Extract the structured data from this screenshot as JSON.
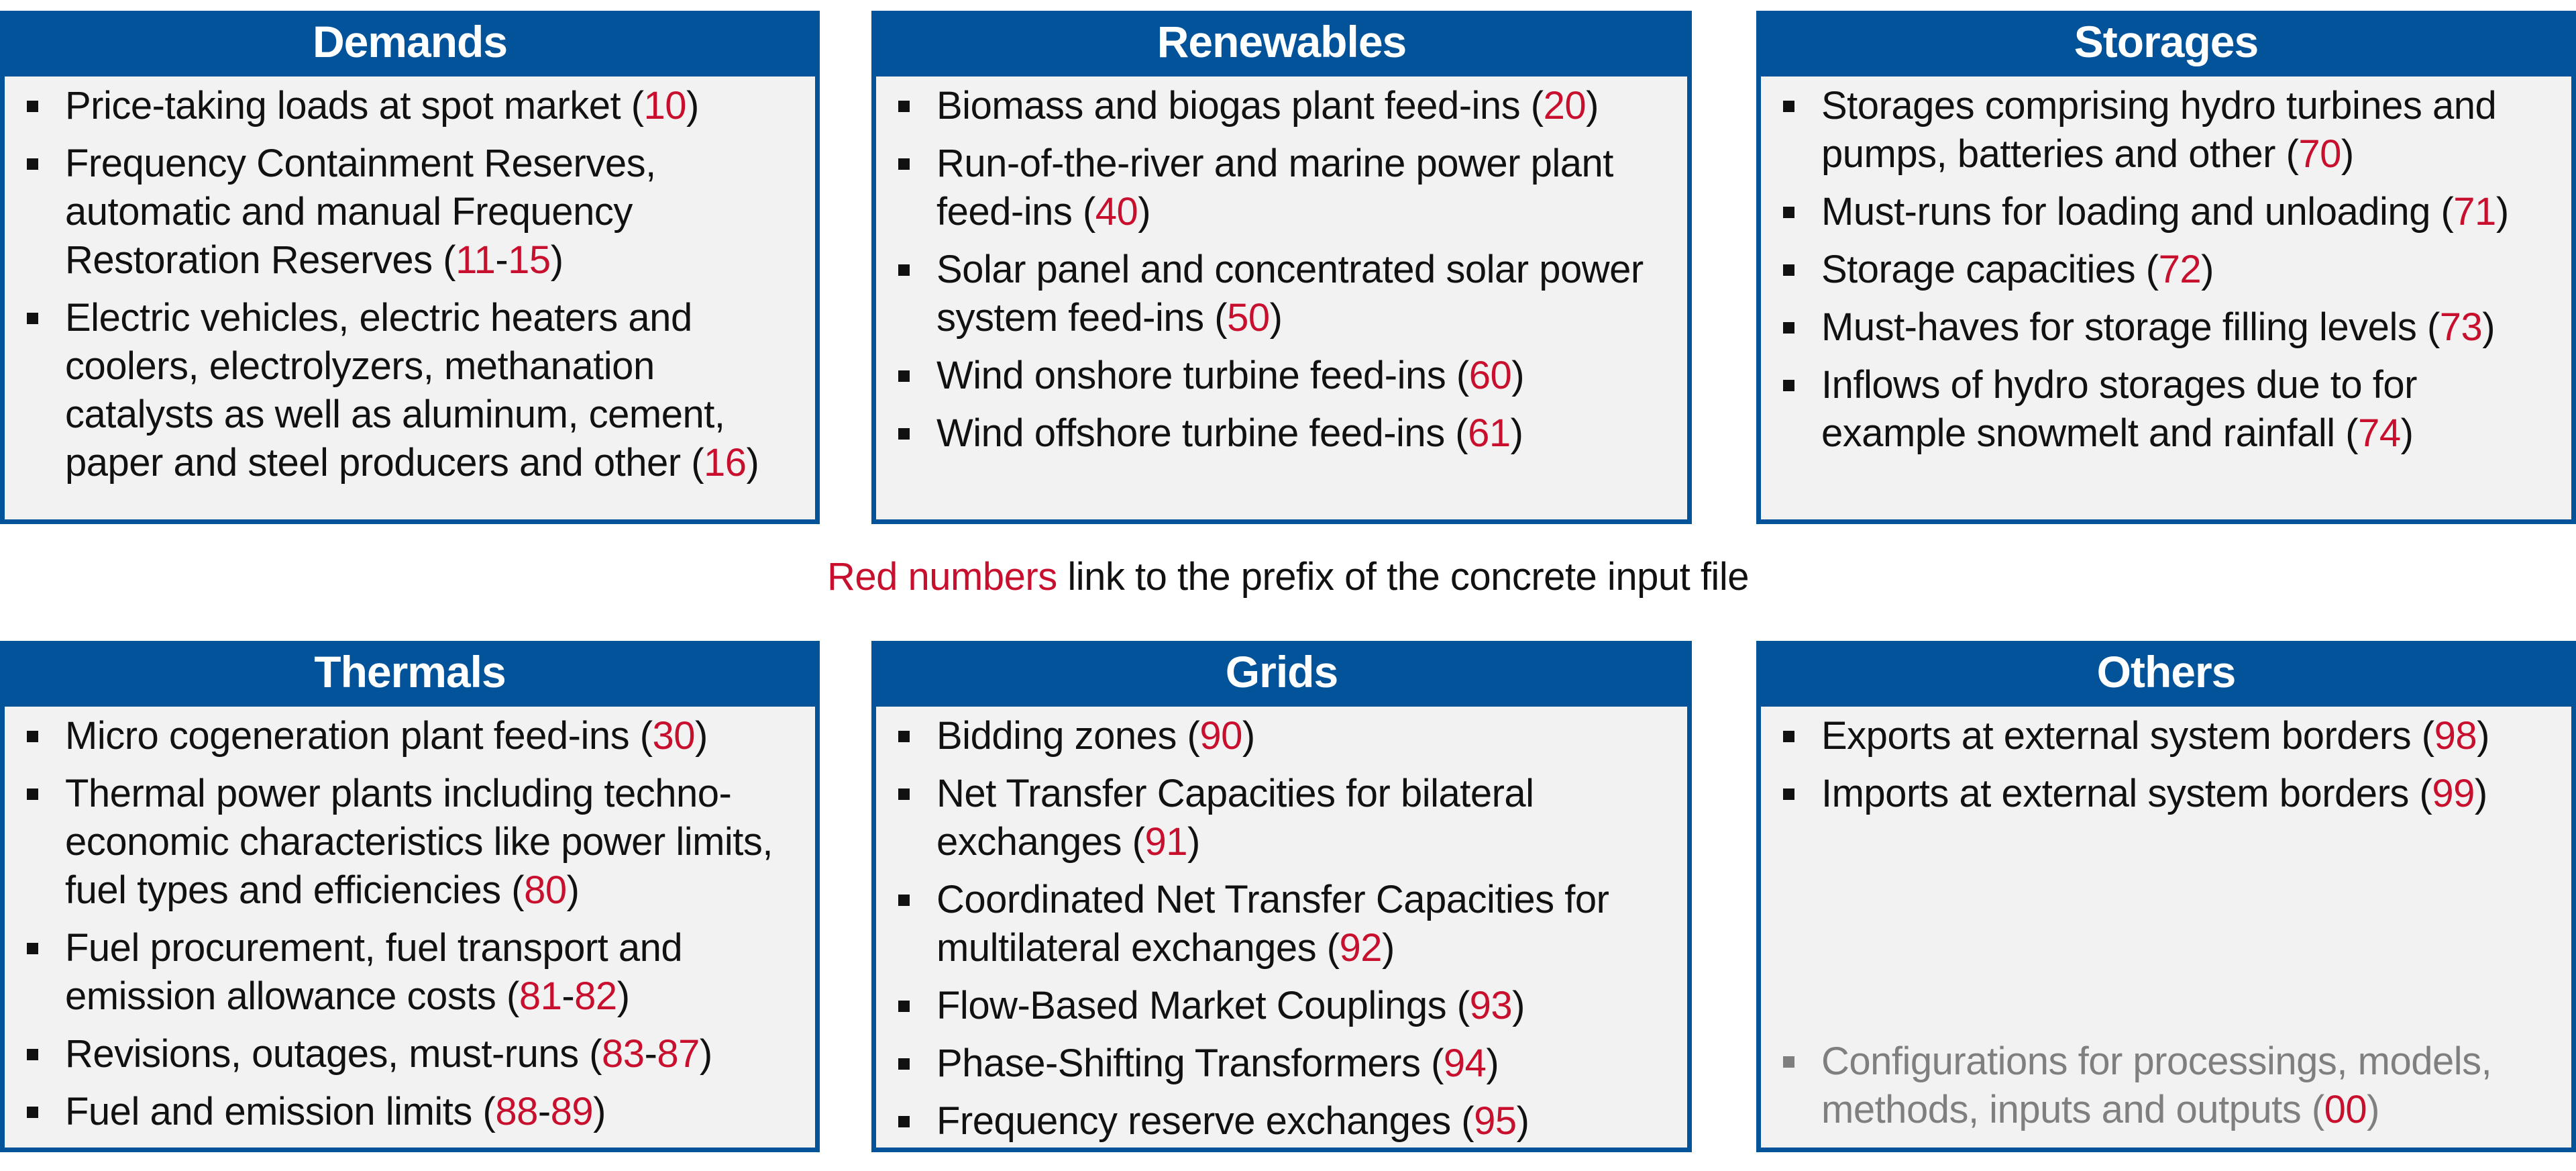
{
  "colors": {
    "header_bg": "#02539a",
    "accent_red": "#c8102e",
    "muted_gray": "#7f7f7f",
    "box_bg": "#f2f2f2"
  },
  "note": {
    "highlight": "Red numbers",
    "rest": " link to the prefix of the concrete input file"
  },
  "boxes": {
    "demands": {
      "title": "Demands",
      "items": [
        {
          "text": "Price-taking loads at spot market (",
          "codes": [
            "10"
          ],
          "close": ")"
        },
        {
          "text": "Frequency Containment Reserves, automatic and manual Frequency Restoration Reserves (",
          "codes": [
            "11",
            "15"
          ],
          "close": ")"
        },
        {
          "text": "Electric vehicles, electric heaters and coolers, electrolyzers, methanation catalysts as well as aluminum, cement, paper and steel producers and other (",
          "codes": [
            "16"
          ],
          "close": ")"
        }
      ]
    },
    "renewables": {
      "title": "Renewables",
      "items": [
        {
          "text": "Biomass and biogas plant feed-ins (",
          "codes": [
            "20"
          ],
          "close": ")"
        },
        {
          "text": "Run-of-the-river and marine power plant feed-ins (",
          "codes": [
            "40"
          ],
          "close": ")"
        },
        {
          "text": "Solar panel and concentrated solar power system feed-ins (",
          "codes": [
            "50"
          ],
          "close": ")"
        },
        {
          "text": "Wind onshore turbine feed-ins (",
          "codes": [
            "60"
          ],
          "close": ")"
        },
        {
          "text": "Wind offshore turbine feed-ins (",
          "codes": [
            "61"
          ],
          "close": ")"
        }
      ]
    },
    "storages": {
      "title": "Storages",
      "items": [
        {
          "text": "Storages comprising hydro turbines and pumps, batteries and other (",
          "codes": [
            "70"
          ],
          "close": ")"
        },
        {
          "text": "Must-runs for loading and unloading (",
          "codes": [
            "71"
          ],
          "close": ")"
        },
        {
          "text": "Storage capacities (",
          "codes": [
            "72"
          ],
          "close": ")"
        },
        {
          "text": "Must-haves for storage filling levels (",
          "codes": [
            "73"
          ],
          "close": ")"
        },
        {
          "text": "Inflows of hydro storages due to for example snowmelt and rainfall (",
          "codes": [
            "74"
          ],
          "close": ")"
        }
      ]
    },
    "thermals": {
      "title": "Thermals",
      "items": [
        {
          "text": "Micro cogeneration plant feed-ins (",
          "codes": [
            "30"
          ],
          "close": ")"
        },
        {
          "text": "Thermal power plants including techno-economic characteristics like power limits, fuel types and efficiencies (",
          "codes": [
            "80"
          ],
          "close": ")"
        },
        {
          "text": "Fuel procurement, fuel transport and emission allowance costs (",
          "codes": [
            "81",
            "82"
          ],
          "close": ")"
        },
        {
          "text": "Revisions, outages, must-runs (",
          "codes": [
            "83",
            "87"
          ],
          "close": ")"
        },
        {
          "text": "Fuel and emission limits (",
          "codes": [
            "88",
            "89"
          ],
          "close": ")"
        }
      ]
    },
    "grids": {
      "title": "Grids",
      "items": [
        {
          "text": "Bidding zones (",
          "codes": [
            "90"
          ],
          "close": ")"
        },
        {
          "text": "Net Transfer Capacities for bilateral exchanges (",
          "codes": [
            "91"
          ],
          "close": ")"
        },
        {
          "text": "Coordinated Net Transfer Capacities for multilateral exchanges (",
          "codes": [
            "92"
          ],
          "close": ")"
        },
        {
          "text": "Flow-Based Market Couplings (",
          "codes": [
            "93"
          ],
          "close": ")"
        },
        {
          "text": "Phase-Shifting Transformers (",
          "codes": [
            "94"
          ],
          "close": ")"
        },
        {
          "text": "Frequency reserve exchanges (",
          "codes": [
            "95"
          ],
          "close": ")"
        }
      ]
    },
    "others": {
      "title": "Others",
      "items": [
        {
          "text": "Exports at external system borders (",
          "codes": [
            "98"
          ],
          "close": ")"
        },
        {
          "text": "Imports at external system borders (",
          "codes": [
            "99"
          ],
          "close": ")"
        }
      ],
      "footer_item": {
        "text": "Configurations for processings, models, methods, inputs and outputs (",
        "codes": [
          "00"
        ],
        "close": ")",
        "muted": true
      }
    }
  }
}
